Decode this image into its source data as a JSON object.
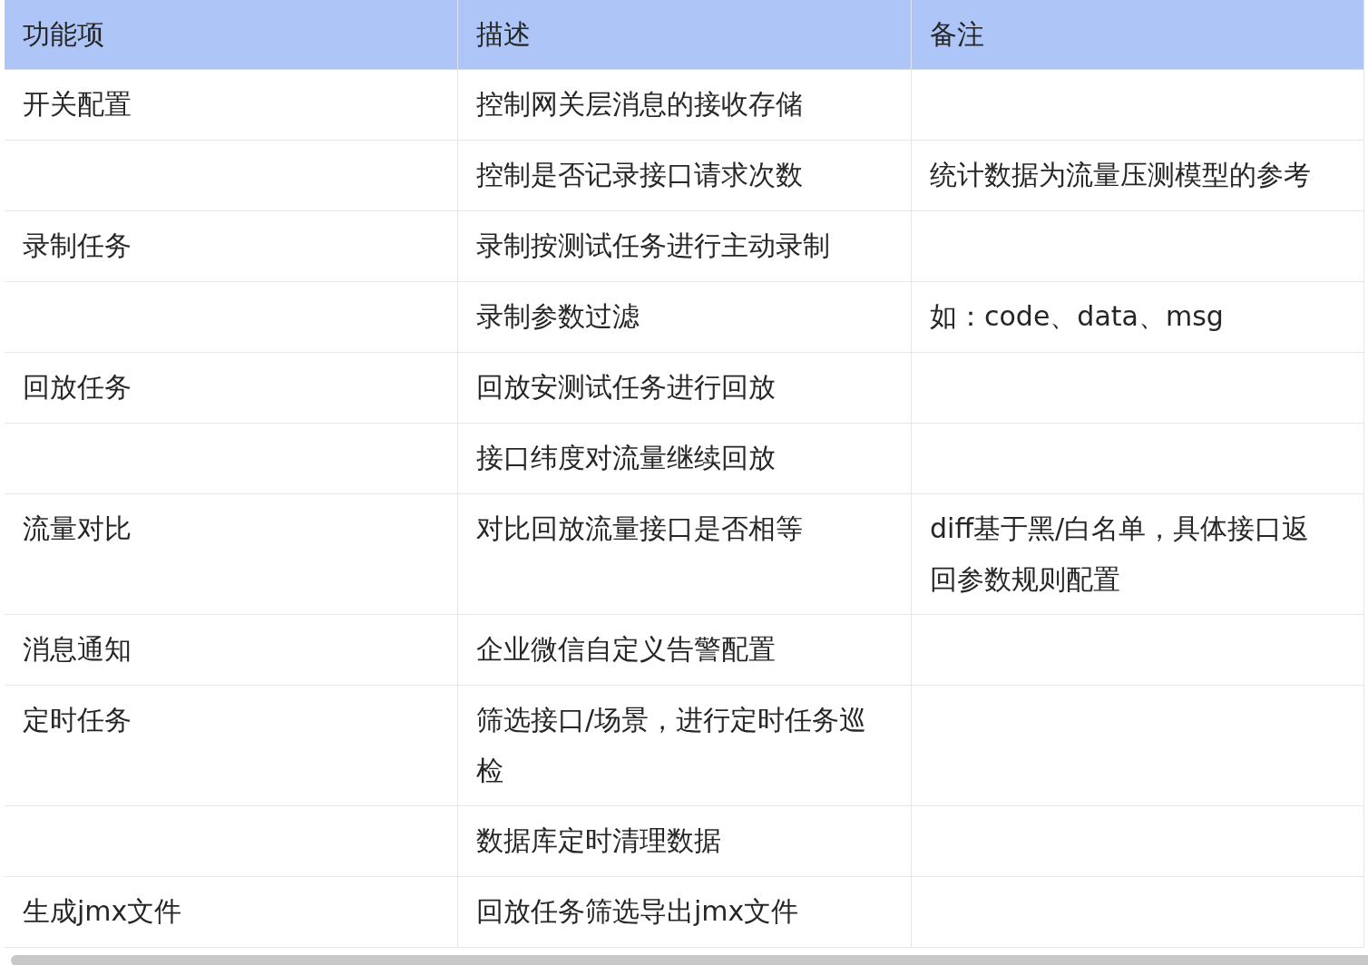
{
  "table": {
    "columns": [
      "功能项",
      "描述",
      "备注"
    ],
    "rows": [
      {
        "feature": "开关配置",
        "description": "控制网关层消息的接收存储"
      },
      {
        "description": "控制是否记录接口请求次数",
        "note": "统计数据为流量压测模型的参考"
      },
      {
        "feature": "录制任务",
        "description": "录制按测试任务进行主动录制"
      },
      {
        "description": "录制参数过滤",
        "note": "如：code、data、msg"
      },
      {
        "feature": "回放任务",
        "description": "回放安测试任务进行回放"
      },
      {
        "description": "接口纬度对流量继续回放"
      },
      {
        "feature": "流量对比",
        "description": "对比回放流量接口是否相等",
        "note": "diff基于黑/白名单，具体接口返回参数规则配置"
      },
      {
        "feature": "消息通知",
        "description": "企业微信自定义告警配置"
      },
      {
        "feature": "定时任务",
        "description": "筛选接口/场景，进行定时任务巡检"
      },
      {
        "description": "数据库定时清理数据"
      },
      {
        "feature": "生成jmx文件",
        "description": "回放任务筛选导出jmx文件"
      }
    ]
  }
}
